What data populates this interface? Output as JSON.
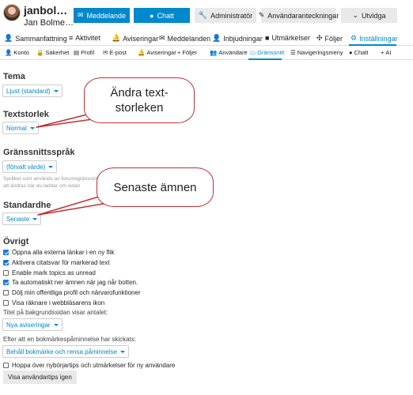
{
  "header": {
    "username": "janbol…",
    "full_name": "Jan Bolme…",
    "buttons": [
      {
        "label": "Meddelande",
        "icon": "envelope-icon"
      },
      {
        "label": "Chatt",
        "icon": "chat-icon"
      },
      {
        "label": "Administratör",
        "icon": "wrench-icon"
      },
      {
        "label": "Användaranteckningar",
        "icon": "pencil-icon"
      },
      {
        "label": "Utvidga",
        "icon": "chevron-down-icon"
      }
    ]
  },
  "tabs": [
    {
      "label": "Sammanfattning",
      "icon": "user-icon"
    },
    {
      "label": "Aktivitet",
      "icon": "stream-icon"
    },
    {
      "label": "Aviseringar",
      "icon": "bell-icon"
    },
    {
      "label": "Meddelanden",
      "icon": "envelope-icon"
    },
    {
      "label": "Inbjudningar",
      "icon": "user-plus-icon"
    },
    {
      "label": "Utmärkelser",
      "icon": "badge-icon"
    },
    {
      "label": "Följer",
      "icon": "follow-icon"
    },
    {
      "label": "Inställningar",
      "icon": "gear-icon",
      "active": true
    }
  ],
  "subtabs": [
    {
      "label": "Konto",
      "icon": "user-icon"
    },
    {
      "label": "Säkerhet",
      "icon": "lock-icon"
    },
    {
      "label": "Profil",
      "icon": "profile-icon"
    },
    {
      "label": "E-post",
      "icon": "envelope-icon"
    },
    {
      "label": "Aviseringar",
      "icon": "bell-icon"
    },
    {
      "label": "Följer",
      "icon": "plus-icon"
    },
    {
      "label": "Användare",
      "icon": "users-icon"
    },
    {
      "label": "Gränssnitt",
      "icon": "desktop-icon",
      "active": true
    },
    {
      "label": "Navigeringsmeny",
      "icon": "bars-icon"
    },
    {
      "label": "Chatt",
      "icon": "chat-icon"
    },
    {
      "label": "AI",
      "icon": "plus-icon"
    }
  ],
  "settings": {
    "theme": {
      "heading": "Tema",
      "value": "Ljust (standard)"
    },
    "text_size": {
      "heading": "Textstorlek",
      "value": "Normal"
    },
    "language": {
      "heading": "Gränssnittsspråk",
      "value": "(förvalt värde)",
      "hint": "Språket som används av forumsgränssnittet. Det kommer att ändras när du laddar om sidan"
    },
    "default_home": {
      "heading": "Standardhemsida",
      "value": "Senaste"
    },
    "other": {
      "heading": "Övrigt",
      "checkboxes": [
        {
          "label": "Öppna alla externa länkar i en ny flik",
          "checked": true
        },
        {
          "label": "Aktivera citatsvar för markerad text",
          "checked": true
        },
        {
          "label": "Enable mark topics as unread",
          "checked": false
        },
        {
          "label": "Ta automatiskt ner ämnen när jag når botten.",
          "checked": true
        },
        {
          "label": "Dölj min offentliga profil och närvarofunktioner",
          "checked": false
        },
        {
          "label": "Visa räknare i webbläsarens ikon",
          "checked": false
        }
      ],
      "bg_title_label": "Titel på bakgrundssidan visar antalet:",
      "bg_title_value": "Nya aviseringar",
      "bookmark_label": "Efter att en bokmärkespåminnelse har skickats:",
      "bookmark_value": "Behåll bokmärke och rensa påminnelse",
      "skip_tips": {
        "label": "Hoppa över nybörjartips och utmärkelser för ny användare",
        "checked": false
      },
      "show_tips_button": "Visa användartips igen"
    }
  },
  "callouts": {
    "text_size": "Ändra text-storleken",
    "latest": "Senaste ämnen"
  },
  "colors": {
    "accent": "#0088cc",
    "callout_border": "#c03030",
    "checkbox": "#1a73e8"
  }
}
